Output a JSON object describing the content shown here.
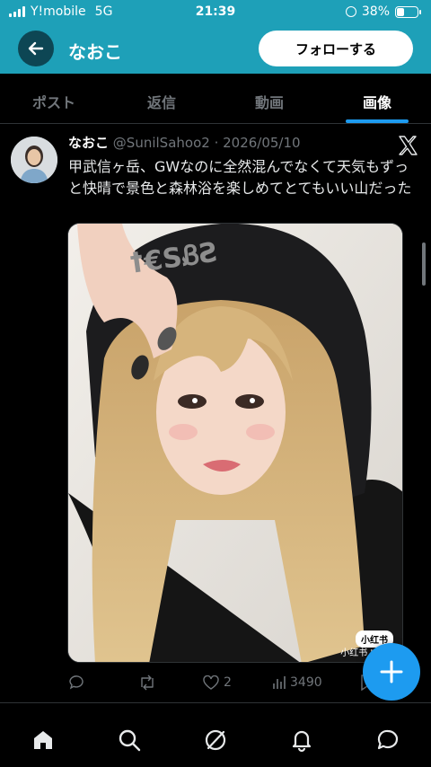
{
  "status": {
    "carrier": "Y!mobile",
    "network": "5G",
    "time": "21:39",
    "battery": "38%",
    "battery_level": 0.38
  },
  "header": {
    "title": "なおこ",
    "follow_label": "フォローする",
    "back_icon": "arrow-left-icon"
  },
  "tabs": [
    {
      "label": "ポスト",
      "active": false
    },
    {
      "label": "返信",
      "active": false
    },
    {
      "label": "動画",
      "active": false
    },
    {
      "label": "画像",
      "active": true
    }
  ],
  "post": {
    "author": "なおこ",
    "handle": "@SunilSahoo2",
    "date": "2026/05/10",
    "text": "甲武信ヶ岳、GWなのに全然混んでなくて天気もずっと快晴で景色と森林浴を楽しめてとてもいい山だった",
    "image_watermark": "小红书 ID: XH",
    "image_badge": "小红书",
    "reply_count": "",
    "retweet_count": "",
    "like_count": "2",
    "view_count": "3490"
  },
  "colors": {
    "header_bg": "#1ea0b8",
    "accent": "#1d9bf0",
    "background": "#000000",
    "muted": "#71767b"
  },
  "bottom_nav": [
    "home-icon",
    "search-icon",
    "grok-icon",
    "notifications-icon",
    "messages-icon"
  ]
}
